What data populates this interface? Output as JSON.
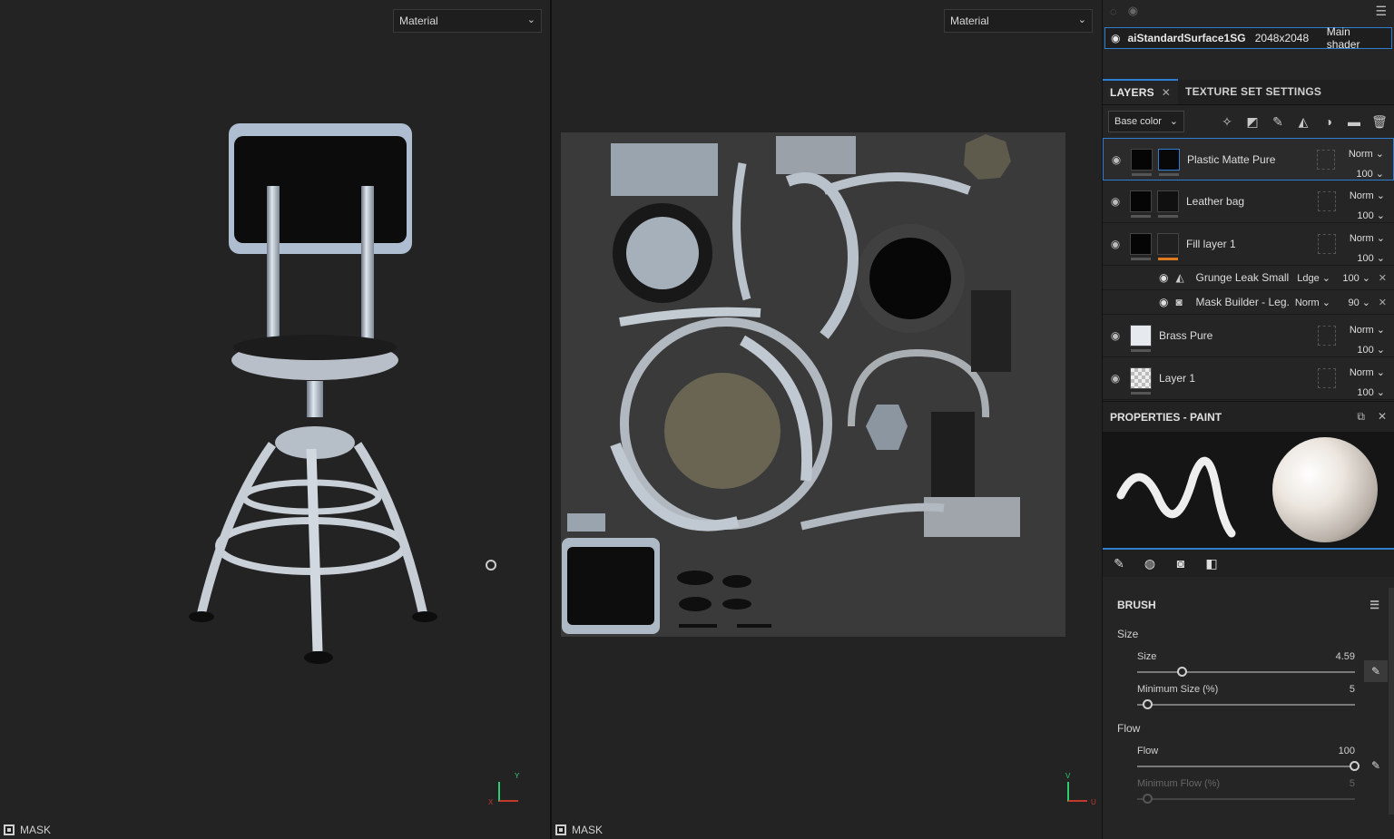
{
  "viewport3d": {
    "mode_select": "Material",
    "mask_label": "MASK",
    "axis_x": "X",
    "axis_y": "Y"
  },
  "viewport2d": {
    "mode_select": "Material",
    "mask_label": "MASK",
    "axis_y": "V",
    "axis_u": "U"
  },
  "shader": {
    "name": "aiStandardSurface1SG",
    "resolution": "2048x2048",
    "shader_type": "Main shader"
  },
  "tabs": {
    "layers": "LAYERS",
    "texture_set_settings": "TEXTURE SET SETTINGS"
  },
  "channel_select": "Base color",
  "layers": [
    {
      "name": "Plastic Matte Pure",
      "blend": "Norm",
      "opacity": "100"
    },
    {
      "name": "Leather bag",
      "blend": "Norm",
      "opacity": "100"
    },
    {
      "name": "Fill layer 1",
      "blend": "Norm",
      "opacity": "100"
    },
    {
      "name": "Brass Pure",
      "blend": "Norm",
      "opacity": "100"
    },
    {
      "name": "Layer 1",
      "blend": "Norm",
      "opacity": "100"
    }
  ],
  "effects": [
    {
      "name": "Grunge Leak Small",
      "blend": "Ldge",
      "value": "100"
    },
    {
      "name": "Mask Builder - Leg...",
      "blend": "Norm",
      "value": "90"
    }
  ],
  "properties": {
    "title": "PROPERTIES - PAINT"
  },
  "brush": {
    "title": "BRUSH",
    "size_group": "Size",
    "flow_group": "Flow",
    "size": {
      "label": "Size",
      "value": "4.59",
      "fraction": 0.21
    },
    "min_size": {
      "label": "Minimum Size (%)",
      "value": "5",
      "fraction": 0.05
    },
    "flow": {
      "label": "Flow",
      "value": "100",
      "fraction": 1.0
    },
    "min_flow": {
      "label": "Minimum Flow (%)",
      "value": "5",
      "fraction": 0.05
    }
  }
}
